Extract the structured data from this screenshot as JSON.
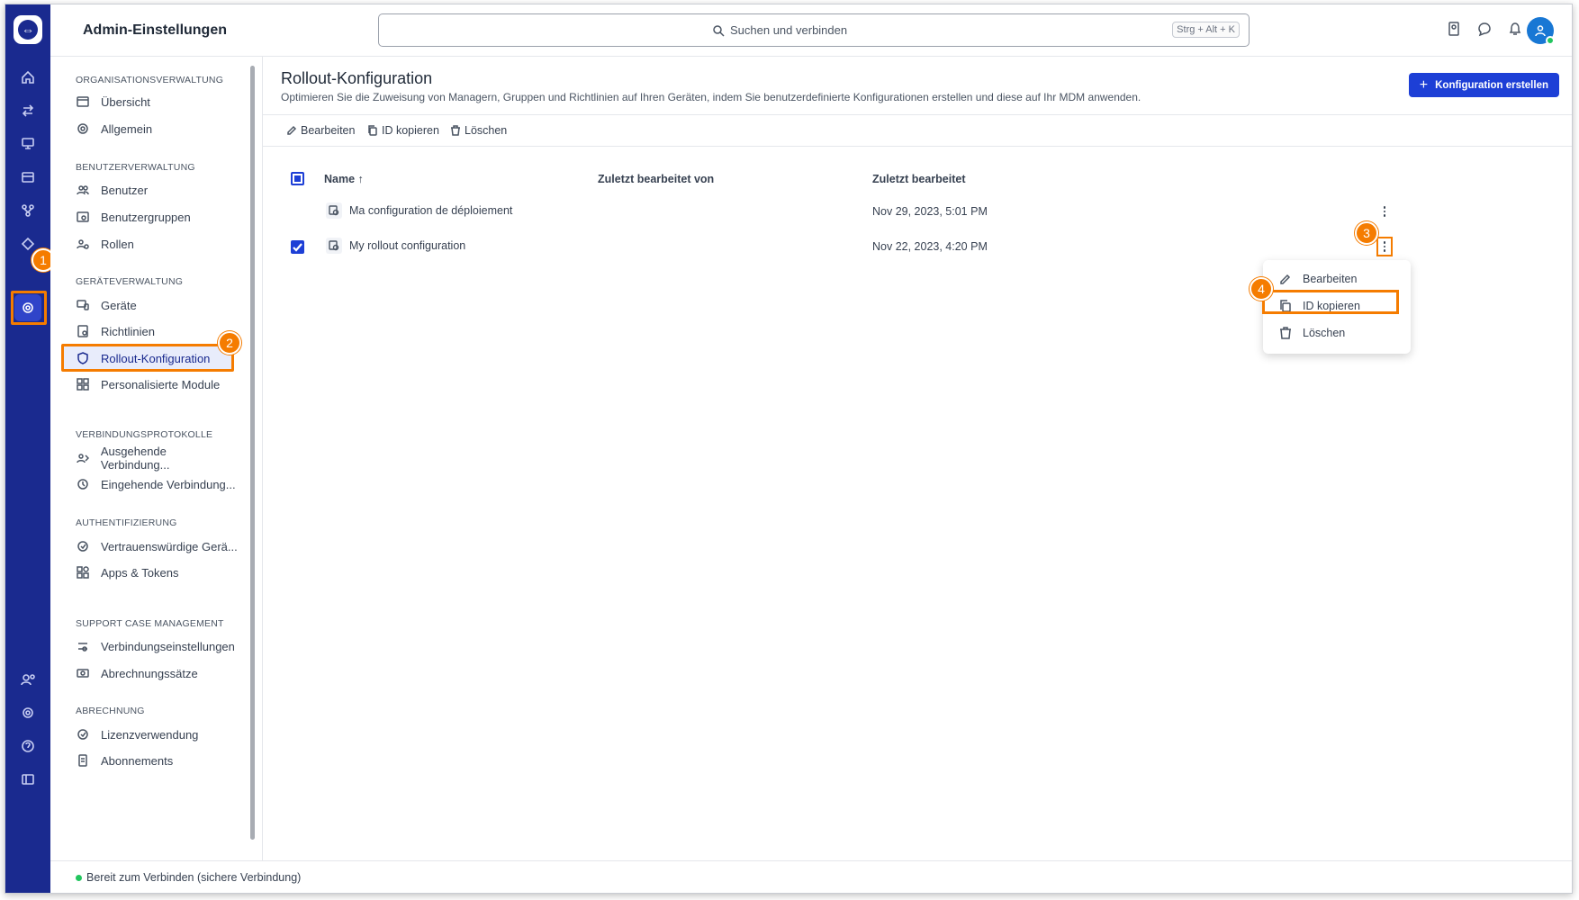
{
  "header": {
    "title": "Admin-Einstellungen",
    "search_placeholder": "Suchen und verbinden",
    "search_shortcut": "Strg + Alt + K"
  },
  "rail": {
    "items": [
      "home-icon",
      "transfer-icon",
      "devices-icon",
      "sessions-icon",
      "connections-icon",
      "tag-icon",
      "admin-settings-icon"
    ],
    "bottom_items": [
      "user-settings-icon",
      "gear-icon",
      "help-icon",
      "sidebar-toggle-icon"
    ]
  },
  "nav": {
    "sections": [
      {
        "title": "ORGANISATIONSVERWALTUNG",
        "items": [
          "Übersicht",
          "Allgemein"
        ]
      },
      {
        "title": "BENUTZERVERWALTUNG",
        "items": [
          "Benutzer",
          "Benutzergruppen",
          "Rollen"
        ]
      },
      {
        "title": "GERÄTEVERWALTUNG",
        "items": [
          "Geräte",
          "Richtlinien",
          "Rollout-Konfiguration",
          "Personalisierte Module"
        ]
      },
      {
        "title": "VERBINDUNGSPROTOKOLLE",
        "items": [
          "Ausgehende Verbindung...",
          "Eingehende Verbindung..."
        ]
      },
      {
        "title": "AUTHENTIFIZIERUNG",
        "items": [
          "Vertrauenswürdige Gerä...",
          "Apps & Tokens"
        ]
      },
      {
        "title": "SUPPORT CASE MANAGEMENT",
        "items": [
          "Verbindungseinstellungen",
          "Abrechnungssätze"
        ]
      },
      {
        "title": "ABRECHNUNG",
        "items": [
          "Lizenzverwendung",
          "Abonnements"
        ]
      }
    ],
    "active_item": "Rollout-Konfiguration"
  },
  "main": {
    "title": "Rollout-Konfiguration",
    "description": "Optimieren Sie die Zuweisung von Managern, Gruppen und Richtlinien auf Ihren Geräten, indem Sie benutzerdefinierte Konfigurationen erstellen und diese auf Ihr MDM anwenden.",
    "create_button": "Konfiguration erstellen",
    "toolbar": {
      "edit": "Bearbeiten",
      "copy_id": "ID kopieren",
      "delete": "Löschen"
    },
    "columns": {
      "name": "Name ↑",
      "edited_by": "Zuletzt bearbeitet von",
      "edited": "Zuletzt bearbeitet"
    },
    "rows": [
      {
        "name": "Ma configuration de déploiement",
        "edited_by": "",
        "edited": "Nov 29, 2023, 5:01 PM",
        "checked": false
      },
      {
        "name": "My rollout configuration",
        "edited_by": "",
        "edited": "Nov 22, 2023, 4:20 PM",
        "checked": true
      }
    ],
    "context_menu": {
      "edit": "Bearbeiten",
      "copy_id": "ID kopieren",
      "delete": "Löschen"
    }
  },
  "markers": [
    "1",
    "2",
    "3",
    "4"
  ],
  "status": {
    "text": "Bereit zum Verbinden (sichere Verbindung)"
  },
  "colors": {
    "rail": "#1a2a8f",
    "primary": "#1d3fd6",
    "highlight": "#f57c00",
    "online": "#22c55e"
  }
}
